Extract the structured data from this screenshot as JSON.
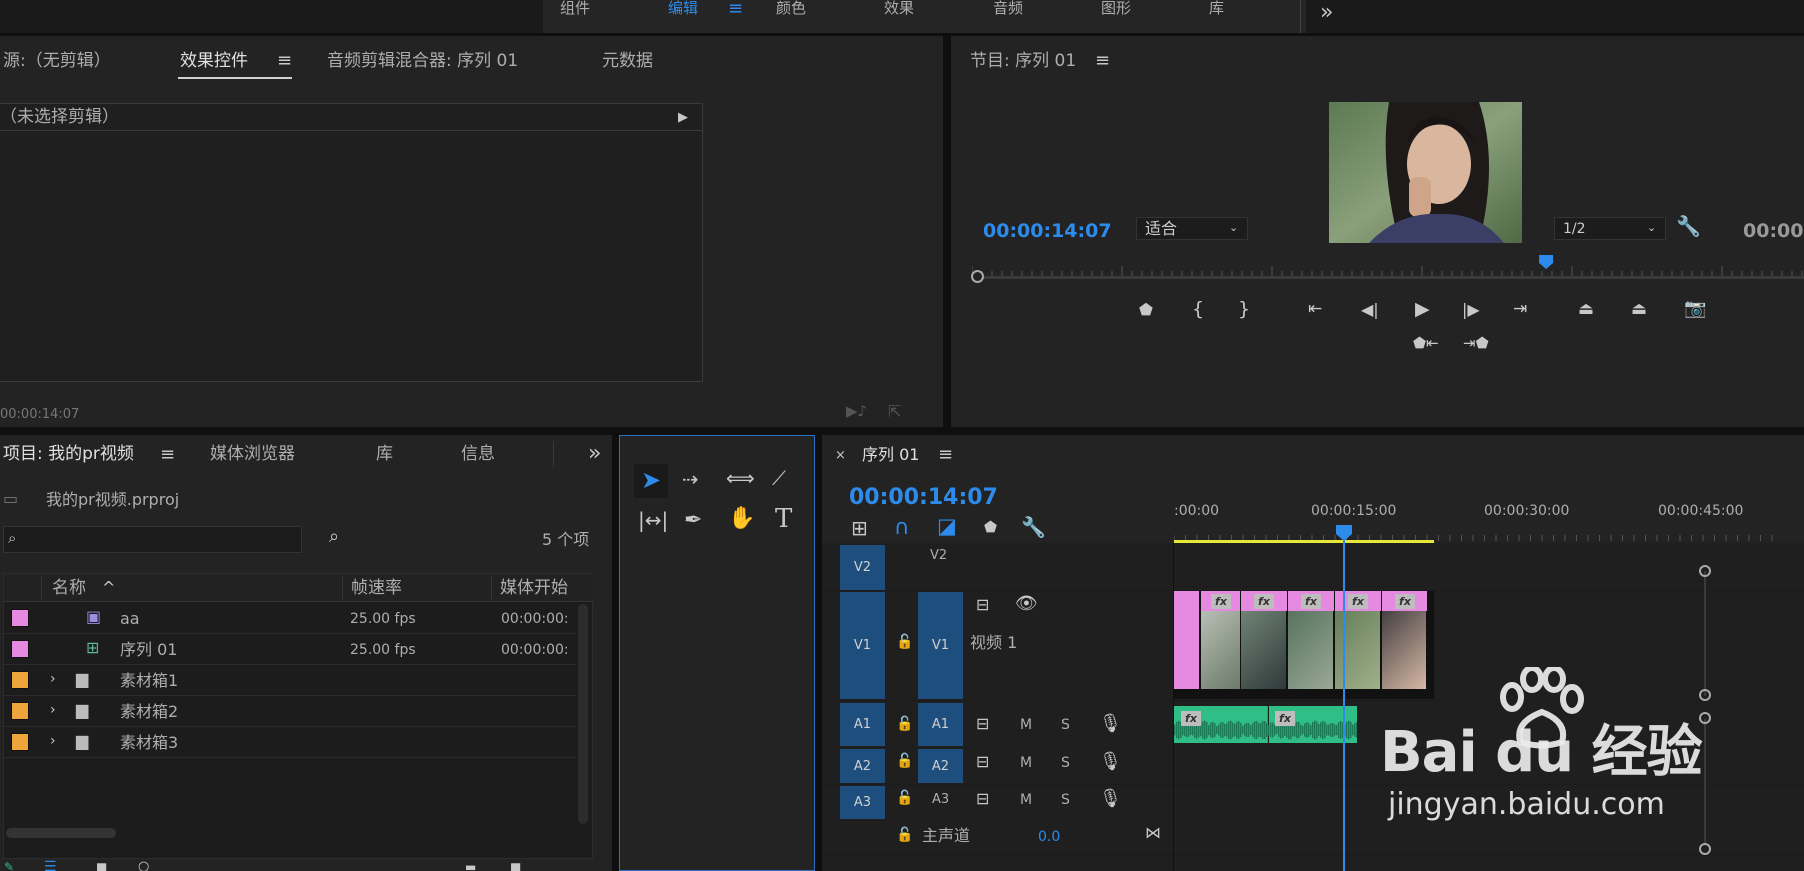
{
  "workspaces": {
    "items": [
      "组件",
      "编辑",
      "颜色",
      "效果",
      "音频",
      "图形",
      "库"
    ],
    "active": "编辑",
    "more": "»"
  },
  "source_panel": {
    "tabs": [
      "源:（无剪辑）",
      "效果控件",
      "音频剪辑混合器: 序列 01",
      "元数据"
    ],
    "active_tab": "效果控件",
    "no_clip": "（未选择剪辑）",
    "timecode": "00:00:14:07"
  },
  "program_panel": {
    "title": "节目: 序列 01",
    "timecode": "00:00:14:07",
    "fit": "适合",
    "resolution": "1/2",
    "duration_partial": "00:00:",
    "playhead_fraction": 0.69
  },
  "project_panel": {
    "tabs": [
      "项目: 我的pr视频",
      "媒体浏览器",
      "库",
      "信息"
    ],
    "file": "我的pr视频.prproj",
    "count": "5 个项",
    "search_placeholder": "",
    "columns": [
      "名称",
      "帧速率",
      "媒体开始"
    ],
    "rows": [
      {
        "color": "#e58ae0",
        "type": "clip",
        "name": "aa",
        "fps": "25.00 fps",
        "start": "00:00:00:"
      },
      {
        "color": "#e58ae0",
        "type": "sequence",
        "name": "序列 01",
        "fps": "25.00 fps",
        "start": "00:00:00:"
      },
      {
        "color": "#f0a53c",
        "type": "bin",
        "name": "素材箱1",
        "fps": "",
        "start": ""
      },
      {
        "color": "#f0a53c",
        "type": "bin",
        "name": "素材箱2",
        "fps": "",
        "start": ""
      },
      {
        "color": "#f0a53c",
        "type": "bin",
        "name": "素材箱3",
        "fps": "",
        "start": ""
      }
    ]
  },
  "timeline": {
    "title": "序列 01",
    "timecode": "00:00:14:07",
    "ruler": [
      ":00:00",
      "00:00:15:00",
      "00:00:30:00",
      "00:00:45:00"
    ],
    "tracks": {
      "v2": "V2",
      "v1": "V1",
      "v1_name": "视频 1",
      "a1": "A1",
      "a2": "A2",
      "a3": "A3",
      "m": "M",
      "s": "S",
      "master": "主声道",
      "master_value": "0.0"
    }
  },
  "watermark": {
    "brand": "Bai du 经验",
    "url": "jingyan.baidu.com"
  },
  "colors": {
    "accent_blue": "#2d8ceb",
    "clip_pink": "#e58ae0",
    "audio_green": "#2fbf86",
    "bin_orange": "#f0a53c",
    "track_blue": "#1d4e7d"
  }
}
